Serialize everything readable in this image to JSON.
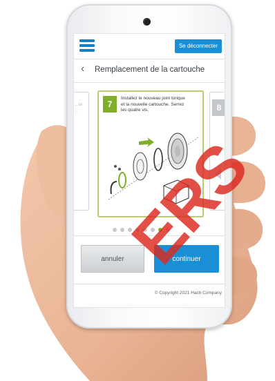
{
  "topbar": {
    "logout_label": "Se déconnecter"
  },
  "header": {
    "title": "Remplacement de la cartouche"
  },
  "carousel": {
    "current_step": "7",
    "current_instruction": "Installez le nouveau joint torique et la nouvelle cartouche. Serrez les quatre vis.",
    "next_step": "8",
    "prev_fragment_1": "...te",
    "prev_fragment_2": "...",
    "dots_total": 8,
    "dots_active": 7
  },
  "actions": {
    "cancel_label": "annuler",
    "continue_label": "continuer"
  },
  "footer": {
    "copyright": "© Copyright 2021 Hach Company"
  },
  "watermark": {
    "text": "ERS"
  },
  "colors": {
    "accent_blue": "#1b8fd6",
    "step_green": "#7fae2b",
    "card_border": "#b7cf6a"
  }
}
